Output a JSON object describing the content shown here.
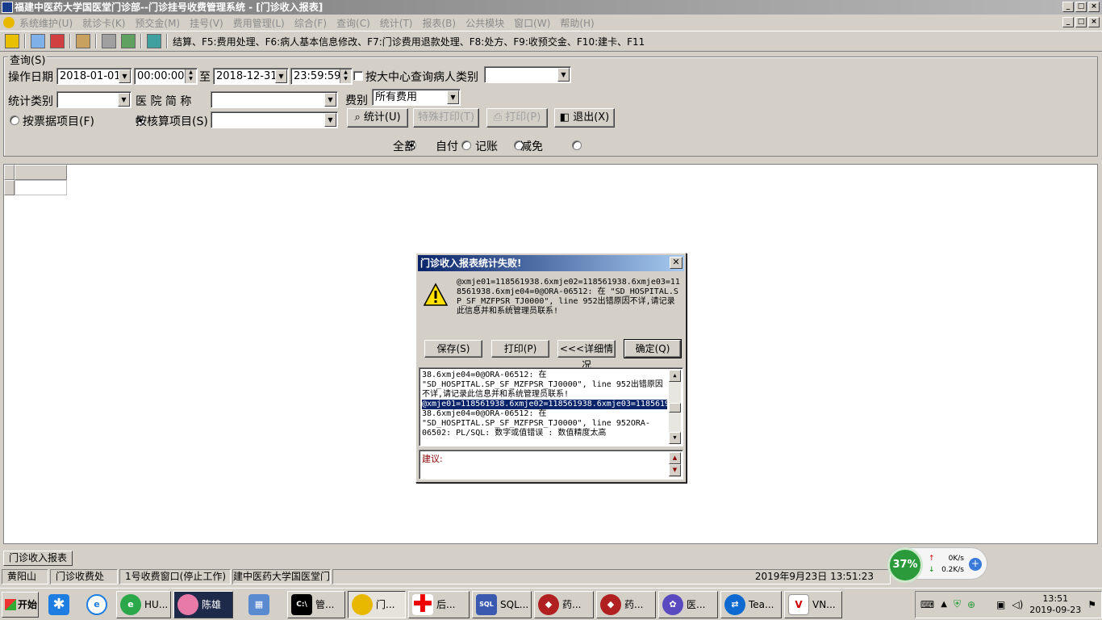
{
  "window": {
    "title": "福建中医药大学国医堂门诊部--门诊挂号收费管理系统 - [门诊收入报表]",
    "controls": [
      "_",
      "□",
      "×"
    ]
  },
  "menu": [
    "系统维护(U)",
    "就诊卡(K)",
    "预交金(M)",
    "挂号(V)",
    "费用管理(L)",
    "综合(F)",
    "查询(C)",
    "统计(T)",
    "报表(B)",
    "公共模块",
    "窗口(W)",
    "帮助(H)"
  ],
  "toolbar": {
    "hotkeys": "结算、F5:费用处理、F6:病人基本信息修改、F7:门诊费用退款处理、F8:处方、F9:收预交金、F10:建卡、F11"
  },
  "query": {
    "group_title": "查询(S)",
    "op_date_label": "操作日期",
    "date_from": "2018-01-01",
    "time_from": "00:00:00",
    "to_label": "至",
    "date_to": "2018-12-31",
    "time_to": "23:59:59",
    "center_query_label": "按大中心查询病人类别",
    "stat_type_label": "统计类别",
    "hospital_label": "医 院 简 称",
    "fee_label": "费别",
    "fee_value": "所有费用",
    "by_receipt_label": "按票据项目(F)",
    "by_account_label": "按核算项目(S)",
    "btn_stat": "统计(U)",
    "btn_special_print": "特殊打印(T)",
    "btn_print": "打印(P)",
    "btn_exit": "退出(X)",
    "pay_options": [
      "全部",
      "自付",
      "记账",
      "减免"
    ]
  },
  "tab": "门诊收入报表",
  "status": {
    "user": "黄阳山",
    "dept": "门诊收费处",
    "window": "1号收费窗口(停止工作)",
    "org": "建中医药大学国医堂门诊",
    "datetime": "2019年9月23日 13:51:23"
  },
  "netmon": {
    "percent": "37%",
    "up": "0K/s",
    "down": "0.2K/s"
  },
  "dialog": {
    "title": "门诊收入报表统计失败!",
    "message": "@xmje01=118561938.6xmje02=118561938.6xmje03=118561938.6xmje04=0@ORA-06512: 在 \"SD_HOSPITAL.SP_SF_MZFPSR_TJ0000\", line 952出错原因不详,请记录此信息并和系统管理员联系!",
    "buttons": [
      "保存(S)",
      "打印(P)",
      "<<<详细情况",
      "确定(Q)"
    ],
    "detail_lines": [
      "38.6xmje04=0@ORA-06512: 在",
      "\"SD_HOSPITAL.SP_SF_MZFPSR_TJ0000\", line 952出错原因",
      "不详,请记录此信息并和系统管理员联系!",
      "@xmje01=118561938.6xmje02=118561938.6xmje03=1185619",
      "38.6xmje04=0@ORA-06512: 在",
      "\"SD_HOSPITAL.SP_SF_MZFPSR_TJ0000\", line 952ORA-",
      "06502: PL/SQL: 数字或值错误 :  数值精度太高"
    ],
    "suggest_label": "建议:"
  },
  "taskbar": {
    "start": "开始",
    "items": [
      "HU...",
      "陈雄",
      "管...",
      "门...",
      "后...",
      "SQL...",
      "药...",
      "药...",
      "医...",
      "Tea...",
      "VN..."
    ],
    "clock_time": "13:51",
    "clock_date": "2019-09-23"
  }
}
